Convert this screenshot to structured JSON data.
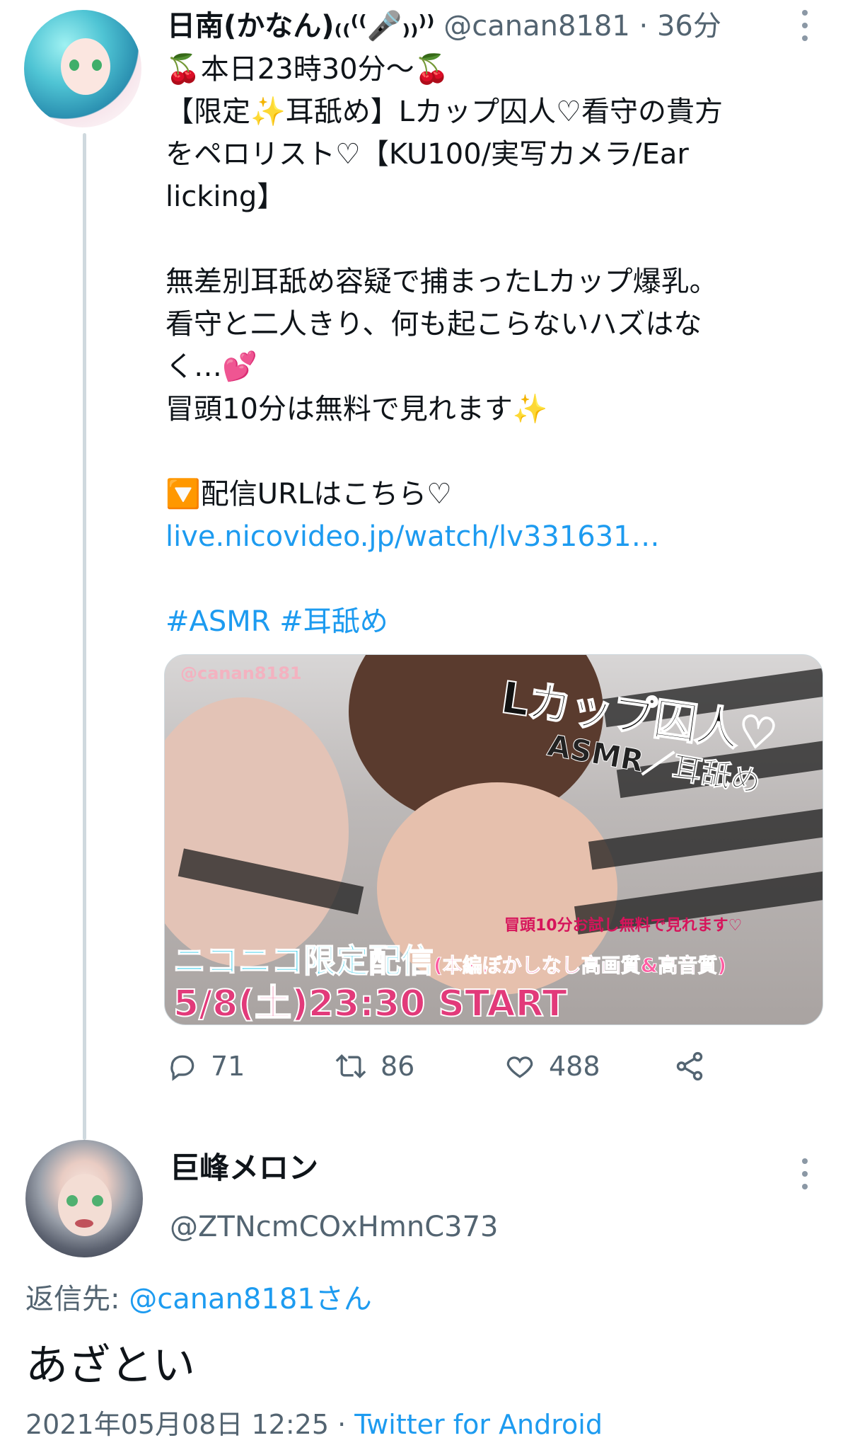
{
  "tweet1": {
    "display_name": "日南(かなん)₍₍⁽⁽🎤₎₎⁾⁾",
    "handle": "@canan8181",
    "separator": "·",
    "time": "36分",
    "lines": [
      "🍒本日23時30分〜🍒",
      "【限定✨耳舐め】Lカップ囚人♡看守の貴方",
      "をペロリスト♡【KU100/実写カメラ/Ear",
      "licking】",
      "",
      "無差別耳舐め容疑で捕まったLカップ爆乳。",
      "看守と二人きり、何も起こらないハズはな",
      "く…💕",
      "冒頭10分は無料で見れます✨",
      "",
      "🔽配信URLはこちら♡"
    ],
    "link": "live.nicovideo.jp/watch/lv331631…",
    "hashtags": "#ASMR #耳舐め",
    "media": {
      "watermark": "@canan8181",
      "title_main": "Lカップ囚人♡",
      "title_sub": "ASMR／耳舐め",
      "note": "冒頭10分お試し無料で見れます♡",
      "nico_main": "ニコニコ限定配信",
      "nico_sub": "(本編ぼかしなし高画質&高音質)",
      "date": "5/8(土)23:30 START"
    },
    "actions": {
      "replies": "71",
      "retweets": "86",
      "likes": "488"
    }
  },
  "tweet2": {
    "display_name": "巨峰メロン",
    "handle": "@ZTNcmCOxHmnC373",
    "reply_to_label": "返信先:",
    "reply_to_user": "@canan8181さん",
    "text": "あざとい",
    "date": "2021年05月08日 12:25",
    "separator": "·",
    "client": "Twitter for Android"
  },
  "colors": {
    "link": "#1d9bf0",
    "muted": "#536471",
    "text": "#0f1419",
    "thread_line": "#cfd9de"
  },
  "icons": [
    "reply-icon",
    "retweet-icon",
    "like-icon",
    "share-icon",
    "more-icon"
  ]
}
